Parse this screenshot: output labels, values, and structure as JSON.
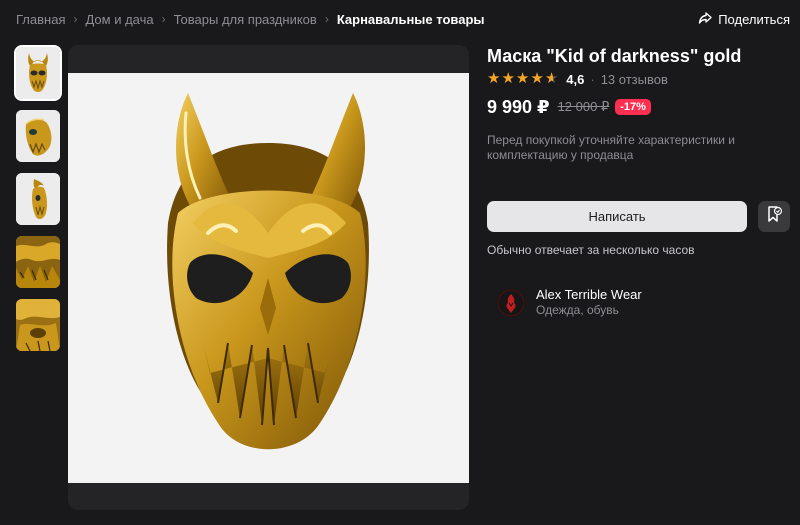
{
  "breadcrumb": {
    "items": [
      "Главная",
      "Дом и дача",
      "Товары для праздников"
    ],
    "current": "Карнавальные товары"
  },
  "share": {
    "label": "Поделиться",
    "icon": "share-icon"
  },
  "gallery": {
    "thumbnail_count": 5,
    "active_thumbnail": 1
  },
  "product": {
    "title": "Маска \"Kid of darkness\" gold",
    "rating": "4,6",
    "rating_stars": 4.6,
    "reviews": "13 отзывов",
    "price": "9 990 ₽",
    "old_price": "12 000 ₽",
    "discount": "-17%",
    "note": "Перед покупкой уточняйте характеристики и комплектацию у продавца"
  },
  "actions": {
    "write_label": "Написать",
    "reply_note": "Обычно отвечает за несколько часов",
    "favorite_icon": "bookmark-icon"
  },
  "seller": {
    "name": "Alex Terrible Wear",
    "category": "Одежда, обувь"
  },
  "colors": {
    "background": "#19191b",
    "panel": "#242426",
    "star": "#f5a623",
    "discount": "#ff2f52",
    "gold": "#c9971c"
  }
}
